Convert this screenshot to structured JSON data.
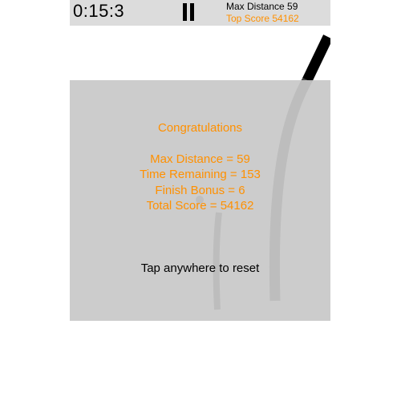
{
  "hud": {
    "timer": "0:15:3",
    "max_distance": "Max Distance 59",
    "top_score": "Top Score 54162"
  },
  "results": {
    "title": "Congratulations",
    "max_distance": "Max Distance = 59",
    "time_remaining": "Time Remaining = 153",
    "finish_bonus": "Finish Bonus = 6",
    "total_score": "Total Score = 54162"
  },
  "reset_prompt": "Tap anywhere to reset",
  "colors": {
    "accent": "#ff9000",
    "hud_background": "#dcdcdc",
    "overlay": "#c8c8c8",
    "track": "#000000",
    "track_shadow": "#8c8c8c"
  }
}
